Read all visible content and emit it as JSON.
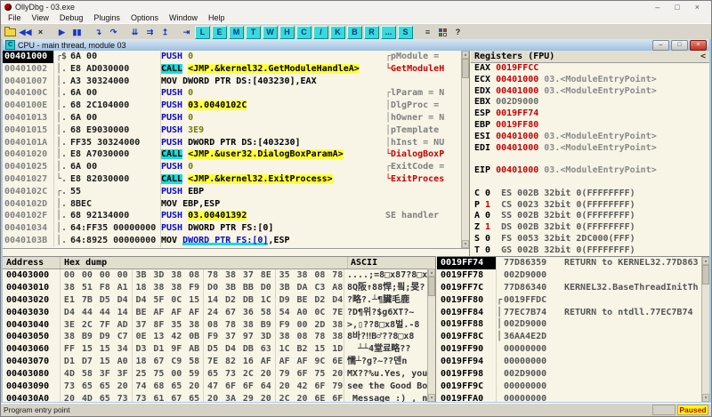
{
  "window": {
    "title": "OllyDbg - 03.exe",
    "controls": [
      "–",
      "□",
      "×"
    ]
  },
  "menu": [
    "File",
    "View",
    "Debug",
    "Plugins",
    "Options",
    "Window",
    "Help"
  ],
  "toolbar": {
    "left_buttons": [
      {
        "name": "open-button",
        "type": "folder"
      },
      {
        "name": "restart-button",
        "icon": "restart-icon",
        "glyph": "◀◀",
        "color": "blue"
      },
      {
        "name": "close-target-button",
        "icon": "close-icon",
        "glyph": "×",
        "color": "dark"
      },
      {
        "name": "run-button",
        "icon": "run-icon",
        "glyph": "▶",
        "color": "blue",
        "gap": true
      },
      {
        "name": "pause-button",
        "icon": "pause-icon",
        "glyph": "▮▮",
        "color": "blue"
      },
      {
        "name": "step-into-button",
        "icon": "step-into-icon",
        "glyph": "↴",
        "color": "blue",
        "gap": true
      },
      {
        "name": "step-over-button",
        "icon": "step-over-icon",
        "glyph": "↷",
        "color": "blue"
      },
      {
        "name": "animate-into-button",
        "icon": "animate-into-icon",
        "glyph": "⇊",
        "color": "blue",
        "gap": true
      },
      {
        "name": "animate-over-button",
        "icon": "animate-over-icon",
        "glyph": "⇉",
        "color": "blue"
      },
      {
        "name": "execute-till-return-button",
        "icon": "execute-till-return-icon",
        "glyph": "↥",
        "color": "blue"
      },
      {
        "name": "goto-button",
        "icon": "goto-icon",
        "glyph": "⇥",
        "color": "blue",
        "gap": true
      }
    ],
    "view_buttons": [
      {
        "name": "view-log-button",
        "label": "L"
      },
      {
        "name": "view-executables-button",
        "label": "E"
      },
      {
        "name": "view-memory-button",
        "label": "M"
      },
      {
        "name": "view-threads-button",
        "label": "T"
      },
      {
        "name": "view-windows-button",
        "label": "W"
      },
      {
        "name": "view-handles-button",
        "label": "H"
      },
      {
        "name": "view-cpu-button",
        "label": "C"
      },
      {
        "name": "view-patches-button",
        "label": "/"
      },
      {
        "name": "view-call-stack-button",
        "label": "K"
      },
      {
        "name": "view-breakpoints-button",
        "label": "B"
      },
      {
        "name": "view-references-button",
        "label": "R"
      },
      {
        "name": "view-run-trace-button",
        "label": "..."
      },
      {
        "name": "view-source-button",
        "label": "S"
      }
    ],
    "right_buttons": [
      {
        "name": "windows-list-button",
        "icon": "windows-list-icon",
        "glyph": "≡",
        "color": "dark",
        "gap": true
      },
      {
        "name": "appearance-button",
        "type": "grid",
        "colors": [
          "#2048C8",
          "#C83020",
          "#28A028",
          "#F0F0F0"
        ]
      },
      {
        "name": "help-button",
        "icon": "help-icon",
        "glyph": "?",
        "color": "dark"
      }
    ]
  },
  "cpu_window": {
    "icon": "C",
    "title": "CPU - main thread, module 03",
    "buttons": [
      "–",
      "□",
      "×"
    ]
  },
  "disasm": {
    "rows": [
      {
        "addr": "00401000",
        "sel": true,
        "br": "┌$",
        "bytes": "6A 00",
        "instr": [
          [
            "mn",
            "PUSH "
          ],
          [
            "nu",
            "0"
          ]
        ],
        "cmt": "┌pModule = ",
        "cmtc": "gray"
      },
      {
        "addr": "00401002",
        "sel": false,
        "br": "│.",
        "bytes": "E8 AD030000",
        "instr": [
          [
            "cb",
            "CALL"
          ],
          [
            "pl",
            " "
          ],
          [
            "yd",
            "<JMP.&kernel32.GetModuleHandleA>"
          ]
        ],
        "cmt": "└GetModuleH",
        "cmtc": "red"
      },
      {
        "addr": "00401007",
        "sel": false,
        "br": "│.",
        "bytes": "A3 30324000",
        "instr": [
          [
            "pl",
            "MOV DWORD PTR DS:[403230],EAX"
          ]
        ],
        "cmt": "",
        "cmtc": "gray"
      },
      {
        "addr": "0040100C",
        "sel": false,
        "br": "│.",
        "bytes": "6A 00",
        "instr": [
          [
            "mn",
            "PUSH "
          ],
          [
            "nu",
            "0"
          ]
        ],
        "cmt": "┌lParam = N",
        "cmtc": "gray"
      },
      {
        "addr": "0040100E",
        "sel": false,
        "br": "│.",
        "bytes": "68 2C104000",
        "instr": [
          [
            "mn",
            "PUSH "
          ],
          [
            "yd",
            "03.0040102C"
          ]
        ],
        "cmt": "│DlgProc = ",
        "cmtc": "gray"
      },
      {
        "addr": "00401013",
        "sel": false,
        "br": "│.",
        "bytes": "6A 00",
        "instr": [
          [
            "mn",
            "PUSH "
          ],
          [
            "nu",
            "0"
          ]
        ],
        "cmt": "│hOwner = N",
        "cmtc": "gray"
      },
      {
        "addr": "00401015",
        "sel": false,
        "br": "│.",
        "bytes": "68 E9030000",
        "instr": [
          [
            "mn",
            "PUSH "
          ],
          [
            "nu",
            "3E9"
          ]
        ],
        "cmt": "│pTemplate",
        "cmtc": "gray"
      },
      {
        "addr": "0040101A",
        "sel": false,
        "br": "│.",
        "bytes": "FF35 30324000",
        "instr": [
          [
            "mn",
            "PUSH "
          ],
          [
            "pl",
            "DWORD PTR DS:[403230]"
          ]
        ],
        "cmt": "│hInst = NU",
        "cmtc": "gray"
      },
      {
        "addr": "00401020",
        "sel": false,
        "br": "│.",
        "bytes": "E8 A7030000",
        "instr": [
          [
            "cb",
            "CALL"
          ],
          [
            "pl",
            " "
          ],
          [
            "yd",
            "<JMP.&user32.DialogBoxParamA>"
          ]
        ],
        "cmt": "└DialogBoxP",
        "cmtc": "red"
      },
      {
        "addr": "00401025",
        "sel": false,
        "br": "│.",
        "bytes": "6A 00",
        "instr": [
          [
            "mn",
            "PUSH "
          ],
          [
            "nu",
            "0"
          ]
        ],
        "cmt": "┌ExitCode =",
        "cmtc": "gray"
      },
      {
        "addr": "00401027",
        "sel": false,
        "br": "└.",
        "bytes": "E8 82030000",
        "instr": [
          [
            "cb",
            "CALL"
          ],
          [
            "pl",
            " "
          ],
          [
            "yd",
            "<JMP.&kernel32.ExitProcess>"
          ]
        ],
        "cmt": "└ExitProces",
        "cmtc": "red"
      },
      {
        "addr": "0040102C",
        "sel": false,
        "br": "┌.",
        "bytes": "55",
        "instr": [
          [
            "mn",
            "PUSH "
          ],
          [
            "pl",
            "EBP"
          ]
        ],
        "cmt": "",
        "cmtc": "gray"
      },
      {
        "addr": "0040102D",
        "sel": false,
        "br": "│.",
        "bytes": "8BEC",
        "instr": [
          [
            "pl",
            "MOV EBP,ESP"
          ]
        ],
        "cmt": "",
        "cmtc": "gray"
      },
      {
        "addr": "0040102F",
        "sel": false,
        "br": "│.",
        "bytes": "68 92134000",
        "instr": [
          [
            "mn",
            "PUSH "
          ],
          [
            "yd",
            "03.00401392"
          ]
        ],
        "cmt": "SE handler",
        "cmtc": "gray"
      },
      {
        "addr": "00401034",
        "sel": false,
        "br": "│.",
        "bytes": "64:FF35 00000000",
        "instr": [
          [
            "mn",
            "PUSH "
          ],
          [
            "pl",
            "DWORD PTR FS:[0]"
          ]
        ],
        "cmt": "",
        "cmtc": "gray"
      },
      {
        "addr": "0040103B",
        "sel": false,
        "br": "│.",
        "bytes": "64:8925 00000000",
        "instr": [
          [
            "pl",
            "MOV "
          ],
          [
            "mc",
            "DWORD PTR FS:[0]"
          ],
          [
            "pl",
            ",ESP"
          ]
        ],
        "cmt": "",
        "cmtc": "gray"
      }
    ]
  },
  "registers": {
    "header_label": "Registers (FPU)",
    "collapse_label": "<",
    "regs": [
      {
        "n": "EAX",
        "v": "0019FFCC",
        "vc": "red",
        "c": ""
      },
      {
        "n": "ECX",
        "v": "00401000",
        "vc": "red",
        "c": "03.<ModuleEntryPoint>"
      },
      {
        "n": "EDX",
        "v": "00401000",
        "vc": "red",
        "c": "03.<ModuleEntryPoint>"
      },
      {
        "n": "EBX",
        "v": "002D9000",
        "vc": "gray",
        "c": ""
      },
      {
        "n": "ESP",
        "v": "0019FF74",
        "vc": "red",
        "c": ""
      },
      {
        "n": "EBP",
        "v": "0019FF80",
        "vc": "red",
        "c": ""
      },
      {
        "n": "ESI",
        "v": "00401000",
        "vc": "red",
        "c": "03.<ModuleEntryPoint>"
      },
      {
        "n": "EDI",
        "v": "00401000",
        "vc": "red",
        "c": "03.<ModuleEntryPoint>"
      },
      {
        "blank": true
      },
      {
        "n": "EIP",
        "v": "00401000",
        "vc": "red",
        "c": "03.<ModuleEntryPoint>"
      },
      {
        "blank": true
      }
    ],
    "flags": [
      {
        "f": "C",
        "v": "0",
        "red": false,
        "seg": "ES 002B 32bit 0(FFFFFFFF)"
      },
      {
        "f": "P",
        "v": "1",
        "red": true,
        "seg": "CS 0023 32bit 0(FFFFFFFF)"
      },
      {
        "f": "A",
        "v": "0",
        "red": false,
        "seg": "SS 002B 32bit 0(FFFFFFFF)"
      },
      {
        "f": "Z",
        "v": "1",
        "red": true,
        "seg": "DS 002B 32bit 0(FFFFFFFF)"
      },
      {
        "f": "S",
        "v": "0",
        "red": false,
        "seg": "FS 0053 32bit 2DC000(FFF)"
      },
      {
        "f": "T",
        "v": "0",
        "red": false,
        "seg": "GS 002B 32bit 0(FFFFFFFF)"
      }
    ]
  },
  "dump": {
    "headers": [
      "Address",
      "Hex dump",
      "ASCII"
    ],
    "rows": [
      {
        "addr": "00403000",
        "bytes": [
          "00",
          "00",
          "00",
          "00",
          "3B",
          "3D",
          "38",
          "08",
          "78",
          "38",
          "37",
          "8E",
          "35",
          "38",
          "08",
          "78"
        ],
        "ascii": "....;=8□x87?8□x"
      },
      {
        "addr": "00403010",
        "bytes": [
          "38",
          "51",
          "F8",
          "A1",
          "18",
          "38",
          "38",
          "F9",
          "D0",
          "3B",
          "BB",
          "D0",
          "3B",
          "DA",
          "C3",
          "A8"
        ],
        "ascii": "8Q阪↑88悍;픸;旻?"
      },
      {
        "addr": "00403020",
        "bytes": [
          "E1",
          "7B",
          "D5",
          "D4",
          "D4",
          "5F",
          "0C",
          "15",
          "14",
          "D2",
          "DB",
          "1C",
          "D9",
          "BE",
          "D2",
          "D4"
        ],
        "ascii": "?略?.┴¶臟毛鹿"
      },
      {
        "addr": "00403030",
        "bytes": [
          "D4",
          "44",
          "44",
          "14",
          "BE",
          "AF",
          "AF",
          "AF",
          "24",
          "67",
          "36",
          "58",
          "54",
          "A0",
          "0C",
          "7E"
        ],
        "ascii": "?D¶위?$g6XT?~"
      },
      {
        "addr": "00403040",
        "bytes": [
          "3E",
          "2C",
          "7F",
          "AD",
          "37",
          "8F",
          "35",
          "38",
          "08",
          "78",
          "38",
          "B9",
          "F9",
          "00",
          "2D",
          "38"
        ],
        "ascii": ">,▯??8□x8벌.-8"
      },
      {
        "addr": "00403050",
        "bytes": [
          "38",
          "B9",
          "D9",
          "C7",
          "0E",
          "13",
          "42",
          "0B",
          "F9",
          "37",
          "97",
          "3D",
          "38",
          "08",
          "78",
          "38"
        ],
        "ascii": "8바?‼B♂??8□x8"
      },
      {
        "addr": "00403060",
        "bytes": [
          "FF",
          "15",
          "15",
          "34",
          "D3",
          "D1",
          "9F",
          "AB",
          "D5",
          "D4",
          "DB",
          "63",
          "1C",
          "B2",
          "15",
          "1D"
        ],
        "ascii": "  ┴┴4堂료略??"
      },
      {
        "addr": "00403070",
        "bytes": [
          "D1",
          "D7",
          "15",
          "A0",
          "18",
          "67",
          "C9",
          "58",
          "7E",
          "82",
          "16",
          "AF",
          "AF",
          "AF",
          "9C",
          "6E"
        ],
        "ascii": "懦┴?g?~??덴n"
      },
      {
        "addr": "00403080",
        "bytes": [
          "4D",
          "58",
          "3F",
          "3F",
          "25",
          "75",
          "00",
          "59",
          "65",
          "73",
          "2C",
          "20",
          "79",
          "6F",
          "75",
          "20"
        ],
        "ascii": "MX??%u.Yes, you "
      },
      {
        "addr": "00403090",
        "bytes": [
          "73",
          "65",
          "65",
          "20",
          "74",
          "68",
          "65",
          "20",
          "47",
          "6F",
          "6F",
          "64",
          "20",
          "42",
          "6F",
          "79"
        ],
        "ascii": "see the Good Boy"
      },
      {
        "addr": "004030A0",
        "bytes": [
          "20",
          "4D",
          "65",
          "73",
          "73",
          "61",
          "67",
          "65",
          "20",
          "3A",
          "29",
          "20",
          "2C",
          "20",
          "6E",
          "6F"
        ],
        "ascii": " Message :) , no"
      }
    ]
  },
  "stack": {
    "rows": [
      {
        "addr": "0019FF74",
        "sel": true,
        "br": "",
        "value": "77D86359",
        "cmt": "RETURN to KERNEL32.77D863"
      },
      {
        "addr": "0019FF78",
        "sel": false,
        "br": "",
        "value": "002D9000",
        "cmt": ""
      },
      {
        "addr": "0019FF7C",
        "sel": false,
        "br": "",
        "value": "77D86340",
        "cmt": "KERNEL32.BaseThreadInitTh"
      },
      {
        "addr": "0019FF80",
        "sel": false,
        "br": "┌",
        "value": "0019FFDC",
        "cmt": ""
      },
      {
        "addr": "0019FF84",
        "sel": false,
        "br": "│",
        "value": "77EC7B74",
        "cmt": "RETURN to ntdll.77EC7B74"
      },
      {
        "addr": "0019FF88",
        "sel": false,
        "br": "│",
        "value": "002D9000",
        "cmt": ""
      },
      {
        "addr": "0019FF8C",
        "sel": false,
        "br": "│",
        "value": "36AA4E2D",
        "cmt": ""
      },
      {
        "addr": "0019FF90",
        "sel": false,
        "br": "",
        "value": "00000000",
        "cmt": ""
      },
      {
        "addr": "0019FF94",
        "sel": false,
        "br": "",
        "value": "00000000",
        "cmt": ""
      },
      {
        "addr": "0019FF98",
        "sel": false,
        "br": "",
        "value": "002D9000",
        "cmt": ""
      },
      {
        "addr": "0019FF9C",
        "sel": false,
        "br": "",
        "value": "00000000",
        "cmt": ""
      },
      {
        "addr": "0019FFA0",
        "sel": false,
        "br": "",
        "value": "00000000",
        "cmt": ""
      }
    ]
  },
  "statusbar": {
    "left": "Program entry point",
    "paused": "Paused"
  },
  "colors": {
    "accent_yellow": "#FFFF3C",
    "accent_cyan": "#18DCDC",
    "value_red": "#C80000",
    "pane_bg": "#F8F5E7"
  }
}
